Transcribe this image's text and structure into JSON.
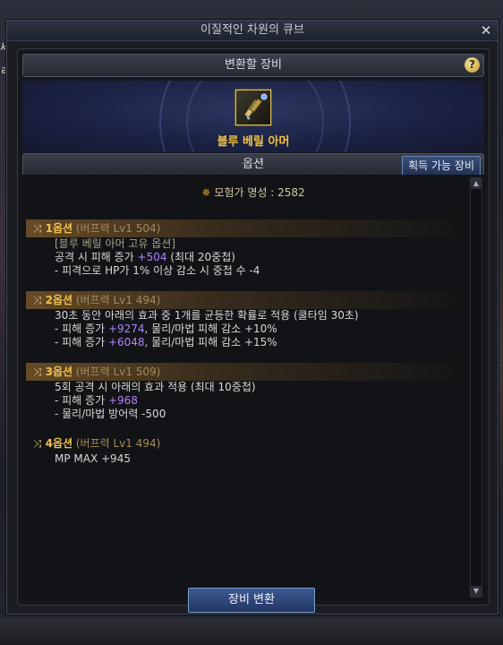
{
  "window": {
    "title": "이질적인 차원의 큐브"
  },
  "background": {
    "left_chars": [
      "세",
      "ㄹ"
    ],
    "right_chars": [
      "끝"
    ]
  },
  "equipment_section": {
    "title": "변환할 장비",
    "item_name": "블루 베릴 아머"
  },
  "options_section": {
    "title": "옵션",
    "get_tab_label": "획득 가능 장비"
  },
  "reputation": {
    "label": "모험가 명성 : 2582"
  },
  "options": [
    {
      "title": "1옵션",
      "level": "(버프력 Lv1 504)",
      "lines": [
        {
          "text": "[블루 베릴 아머 고유 옵션]",
          "muted": true
        },
        {
          "pre": "공격 시 피해 증가 ",
          "val": "+504",
          "post": " (최대 20중첩)"
        },
        {
          "pre": "- 피격으로 HP가 1% 이상 감소 시 중첩 수 -4"
        }
      ]
    },
    {
      "title": "2옵션",
      "level": "(버프력 Lv1 494)",
      "lines": [
        {
          "pre": "30초 동안 아래의 효과 중 1개를 균등한 확률로 적용 (쿨타임 30초)"
        },
        {
          "pre": "- 피해 증가 ",
          "val": "+9274",
          "post": ", 물리/마법 피해 감소 +10%"
        },
        {
          "pre": "- 피해 증가 ",
          "val": "+6048",
          "post": ", 물리/마법 피해 감소 +15%"
        }
      ]
    },
    {
      "title": "3옵션",
      "level": "(버프력 Lv1 509)",
      "lines": [
        {
          "pre": "5회 공격 시 아래의 효과 적용 (최대 10중첩)"
        },
        {
          "pre": "- 피해 증가 ",
          "val": "+968"
        },
        {
          "pre": "- 물리/마법 방어력 -500"
        }
      ]
    },
    {
      "title": "4옵션",
      "level": "(버프력 Lv1 494)",
      "plain": true,
      "lines": [
        {
          "pre": "MP MAX  +945"
        }
      ]
    }
  ],
  "footer": {
    "convert_button": "장비 변환"
  },
  "colors": {
    "gold": "#f0c050",
    "value_purple": "#b083ff",
    "button_blue": "#2c4577"
  }
}
